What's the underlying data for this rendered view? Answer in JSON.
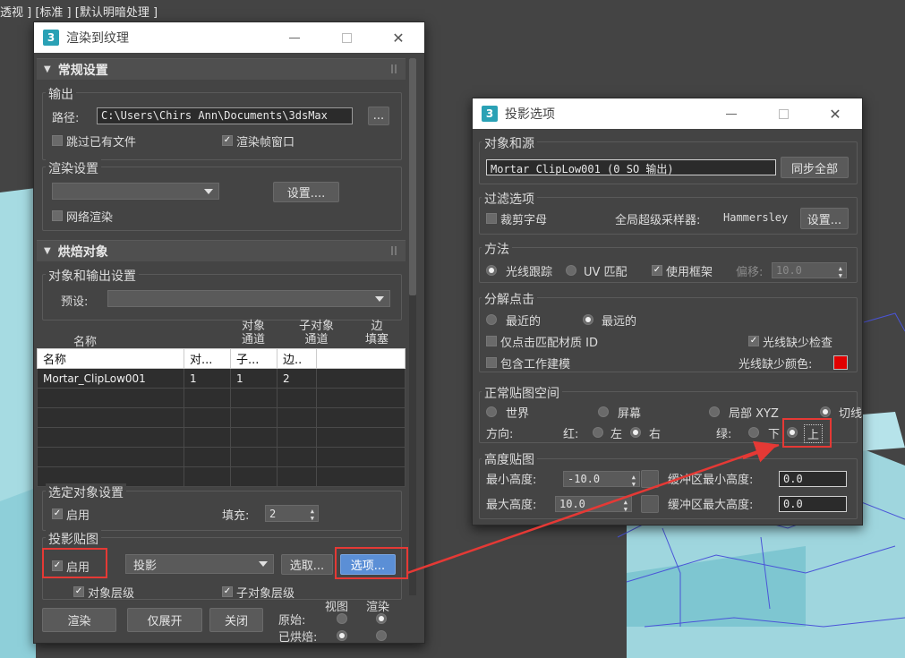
{
  "viewport": {
    "label": "透视 ] [标准 ] [默认明暗处理 ]"
  },
  "render_dialog": {
    "title": "渲染到纹理",
    "rollout_general": "常规设置",
    "output_group": "输出",
    "path_label": "路径:",
    "path_value": "C:\\Users\\Chirs Ann\\Documents\\3dsMax",
    "browse_label": "...",
    "skip_existing": "跳过已有文件",
    "render_frame_window": "渲染帧窗口",
    "render_settings_group": "渲染设置",
    "setup_button": "设置....",
    "network_render": "网络渲染",
    "rollout_bake": "烘焙对象",
    "object_output_group": "对象和输出设置",
    "preset_label": "预设:",
    "col_headers": {
      "name": "名称",
      "obj_channel": "对象\n通道",
      "sub_channel": "子对象\n通道",
      "edge_padding": "边\n填塞"
    },
    "table_header": [
      "名称",
      "对...",
      "子...",
      "边.."
    ],
    "table_rows": [
      [
        "Mortar_ClipLow001",
        "1",
        "1",
        "2"
      ]
    ],
    "selected_settings_group": "选定对象设置",
    "enable_label": "启用",
    "padding_label": "填充:",
    "padding_value": "2",
    "projection_group": "投影贴图",
    "projection_enable": "启用",
    "projection_type": "投影",
    "pick_button": "选取...",
    "options_button": "选项...",
    "object_level": "对象层级",
    "subobject_level": "子对象层级",
    "render_button": "渲染",
    "unwrap_only_button": "仅展开",
    "close_button": "关闭",
    "view_label": "视图",
    "render_label": "渲染",
    "original_label": "原始:",
    "baked_label": "已烘焙:"
  },
  "projection_dialog": {
    "title": "投影选项",
    "object_source_group": "对象和源",
    "object_value": "Mortar_ClipLow001 (0 SO 输出)",
    "sync_all_button": "同步全部",
    "filter_group": "过滤选项",
    "crop_alpha": "裁剪字母",
    "global_sampler_label": "全局超级采样器:",
    "global_sampler_value": "Hammersley",
    "settings_button": "设置...",
    "method_group": "方法",
    "raytrace": "光线跟踪",
    "uv_match": "UV 匹配",
    "use_cage": "使用框架",
    "offset_label": "偏移:",
    "offset_value": "10.0",
    "resolve_hit_group": "分解点击",
    "closest": "最近的",
    "furthest": "最远的",
    "hit_matching_mtl": "仅点击匹配材质 ID",
    "ray_miss_check": "光线缺少检查",
    "include_working_model": "包含工作建模",
    "ray_miss_color": "光线缺少颜色:",
    "normal_space_group": "正常贴图空间",
    "world": "世界",
    "screen": "屏幕",
    "local_xyz": "局部 XYZ",
    "tangent": "切线",
    "orientation": "方向:",
    "red": "红:",
    "left": "左",
    "right": "右",
    "green": "绿:",
    "down": "下",
    "up": "上",
    "height_group": "高度贴图",
    "min_height_label": "最小高度:",
    "min_height_value": "-10.0",
    "max_height_label": "最大高度:",
    "max_height_value": "10.0",
    "buffer_min_label": "缓冲区最小高度:",
    "buffer_min_value": "0.0",
    "buffer_max_label": "缓冲区最大高度:",
    "buffer_max_value": "0.0"
  },
  "colors": {
    "annotation": "#e53935",
    "highlight_button": "#5b8fd6",
    "miss_color": "#e00000"
  }
}
